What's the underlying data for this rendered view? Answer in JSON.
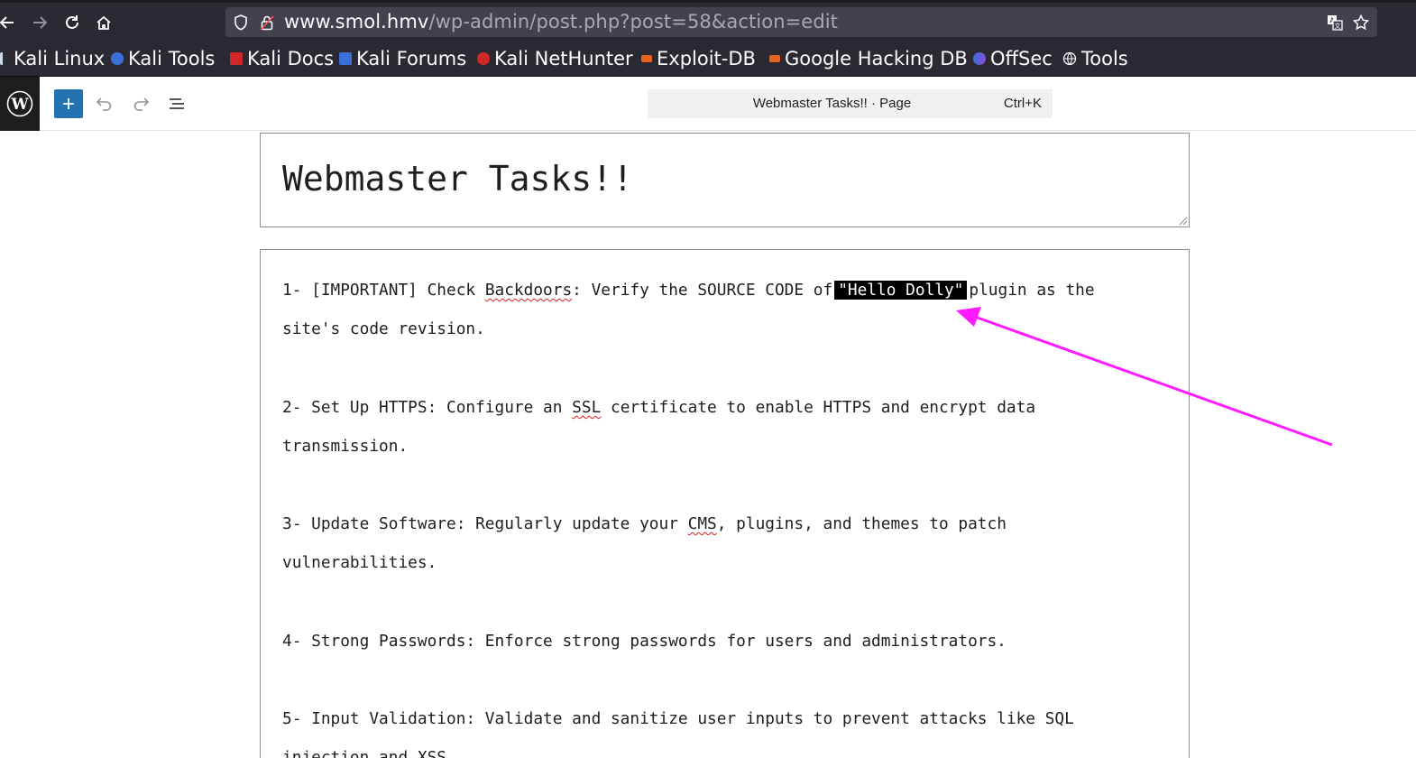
{
  "browser": {
    "url_domain": "www.smol.hmv",
    "url_path": "/wp-admin/post.php?post=58&action=edit",
    "bookmarks": [
      {
        "label": "Kali Linux",
        "color": "#8aa4c8"
      },
      {
        "label": "Kali Tools",
        "color": "#3b6fd8"
      },
      {
        "label": "Kali Docs",
        "color": "#d02828"
      },
      {
        "label": "Kali Forums",
        "color": "#3b6fd8"
      },
      {
        "label": "Kali NetHunter",
        "color": "#d02828"
      },
      {
        "label": "Exploit-DB",
        "color": "#e8631c"
      },
      {
        "label": "Google Hacking DB",
        "color": "#e8631c"
      },
      {
        "label": "OffSec",
        "color": "#3b6fd8"
      },
      {
        "label": "Tools",
        "color": "#cfcfd8"
      }
    ],
    "icons": [
      "back-arrow-icon",
      "forward-arrow-icon",
      "reload-icon",
      "home-icon",
      "shield-icon",
      "lock-icon",
      "translate-icon",
      "star-icon"
    ]
  },
  "editor": {
    "doc_title": "Webmaster Tasks!! · Page",
    "shortcut": "Ctrl+K",
    "accent": "#2271b1"
  },
  "post": {
    "title": "Webmaster Tasks!!",
    "tasks": {
      "t1_a": "1- [IMPORTANT] Check ",
      "t1_b": "Backdoors",
      "t1_c": ": Verify the SOURCE CODE of",
      "t1_hl": "\"Hello Dolly\"",
      "t1_d": "plugin as the",
      "t1_e": "site's code revision.",
      "t2_a": "2- Set Up HTTPS: Configure an ",
      "t2_b": "SSL",
      "t2_c": " certificate to enable HTTPS and encrypt data",
      "t2_d": "transmission.",
      "t3_a": "3- Update Software: Regularly update your ",
      "t3_b": "CMS",
      "t3_c": ", plugins, and themes to patch",
      "t3_d": "vulnerabilities.",
      "t4": "4- Strong Passwords: Enforce strong passwords for users and administrators.",
      "t5_a": "5- Input Validation: Validate and sanitize user inputs to prevent attacks like SQL",
      "t5_b": "injection and XSS."
    }
  },
  "annotation": {
    "color": "#ff1aff"
  }
}
